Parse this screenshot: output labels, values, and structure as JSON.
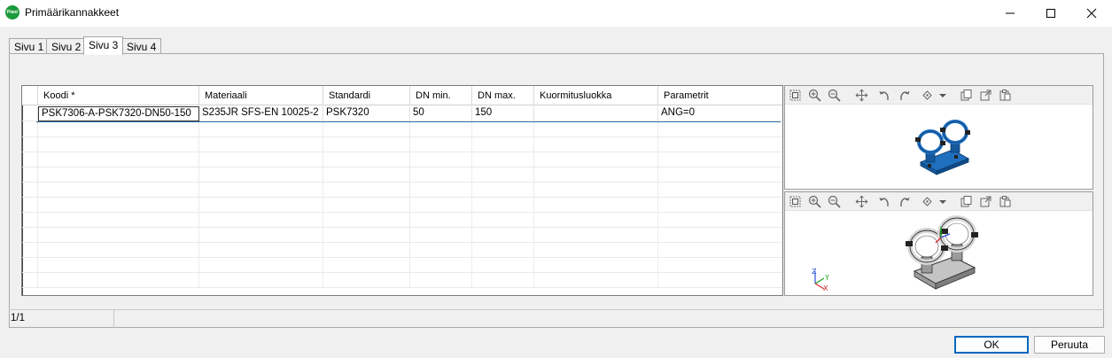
{
  "window": {
    "title": "Primäärikannakkeet",
    "app_icon_text": "Plant",
    "controls": [
      "minimize-icon",
      "maximize-icon",
      "close-icon"
    ]
  },
  "tabs": [
    {
      "label": "Sivu 1",
      "active": false
    },
    {
      "label": "Sivu 2",
      "active": false
    },
    {
      "label": "Sivu 3",
      "active": true
    },
    {
      "label": "Sivu 4",
      "active": false
    }
  ],
  "grid": {
    "columns": [
      "Koodi *",
      "Materiaali",
      "Standardi",
      "DN min.",
      "DN max.",
      "Kuormitusluokka",
      "Parametrit"
    ],
    "rows": [
      {
        "code": "PSK7306-A-PSK7320-DN50-150",
        "material": "S235JR SFS-EN 10025-2",
        "standard": "PSK7320",
        "dn_min": "50",
        "dn_max": "150",
        "load_class": "",
        "parameters": "ANG=0"
      }
    ]
  },
  "viewer_toolbar": [
    "zoom-extents-icon",
    "zoom-in-icon",
    "zoom-out-icon",
    "pan-icon",
    "rotate-left-icon",
    "rotate-right-icon",
    "view-mode-icon",
    "dropdown-arrow-icon",
    "copy-icon",
    "export-icon",
    "paste-icon"
  ],
  "viewer_axes": {
    "z": "Z",
    "y": "Y",
    "x": "X"
  },
  "colors": {
    "selected_blue": "#1f6fbf",
    "render_gray": "#a8a8a8",
    "accent": "#0067c0"
  },
  "status": {
    "count": "1/1"
  },
  "buttons": {
    "ok": "OK",
    "cancel": "Peruuta"
  }
}
